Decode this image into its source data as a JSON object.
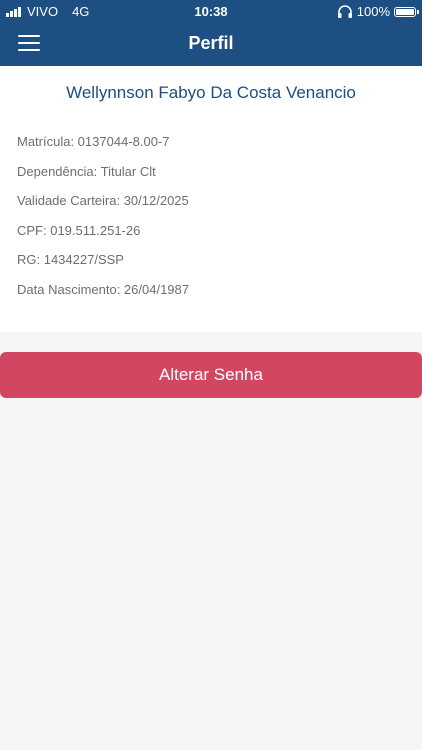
{
  "status_bar": {
    "carrier": "VIVO",
    "network": "4G",
    "time": "10:38",
    "battery": "100%",
    "icons": [
      "signal-icon",
      "headphones-icon",
      "battery-icon"
    ]
  },
  "header": {
    "title": "Perfil",
    "menu_icon": "hamburger-menu-icon"
  },
  "profile": {
    "name": "Wellynnson Fabyo Da Costa Venancio",
    "details": [
      "Matrícula: 0137044-8.00-7",
      "Dependência: Titular Clt",
      "Validade Carteira: 30/12/2025",
      "CPF: 019.511.251-26",
      "RG: 1434227/SSP",
      "Data Nascimento: 26/04/1987"
    ]
  },
  "actions": {
    "change_password_label": "Alterar Senha"
  },
  "colors": {
    "header_bg": "#1d4f82",
    "accent_button": "#d34662",
    "name_text": "#1d4f82",
    "detail_text": "#6e6e6e",
    "page_bg": "#f5f5f5",
    "card_bg": "#ffffff"
  }
}
